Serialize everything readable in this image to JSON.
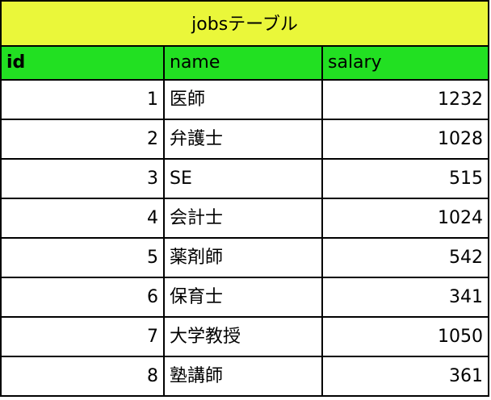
{
  "table": {
    "title": "jobsテーブル",
    "headers": {
      "id": "id",
      "name": "name",
      "salary": "salary"
    },
    "rows": [
      {
        "id": "1",
        "name": "医師",
        "salary": "1232"
      },
      {
        "id": "2",
        "name": "弁護士",
        "salary": "1028"
      },
      {
        "id": "3",
        "name": "SE",
        "salary": "515"
      },
      {
        "id": "4",
        "name": "会計士",
        "salary": "1024"
      },
      {
        "id": "5",
        "name": "薬剤師",
        "salary": "542"
      },
      {
        "id": "6",
        "name": "保育士",
        "salary": "341"
      },
      {
        "id": "7",
        "name": "大学教授",
        "salary": "1050"
      },
      {
        "id": "8",
        "name": "塾講師",
        "salary": "361"
      }
    ]
  },
  "colors": {
    "title_background": "#eaf73a",
    "header_background": "#22e022",
    "border": "#000000"
  }
}
